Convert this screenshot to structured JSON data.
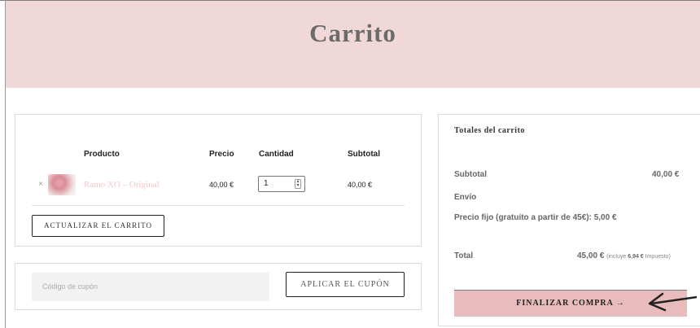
{
  "page": {
    "title": "Carrito"
  },
  "cart": {
    "headers": {
      "product": "Producto",
      "price": "Precio",
      "quantity": "Cantidad",
      "subtotal": "Subtotal"
    },
    "items": [
      {
        "remove": "×",
        "thumbnail_icon": "flower-bouquet-image",
        "name": "Ramo XO – Original",
        "price": "40,00 €",
        "quantity": "1",
        "subtotal": "40,00 €"
      }
    ],
    "update_button": "ACTUALIZAR EL CARRITO"
  },
  "coupon": {
    "placeholder": "Código de cupón",
    "apply_button": "APLICAR EL CUPÓN"
  },
  "totals": {
    "title": "Totales del carrito",
    "subtotal_label": "Subtotal",
    "subtotal_value": "40,00 €",
    "shipping_label": "Envío",
    "shipping_text": "Precio fijo (gratuito a partir de 45€): 5,00 €",
    "total_label": "Total",
    "total_value": "45,00 €",
    "tax_prefix": "(incluye",
    "tax_amount": "6,94 €",
    "tax_suffix": "Impuesto)",
    "checkout_button": "FINALIZAR COMPRA →"
  },
  "colors": {
    "hero_bg": "#f1d8d8",
    "checkout_bg": "#e8bcbc",
    "product_link": "#f3c8cf"
  },
  "annotation": {
    "icon": "arrow-pointer-icon"
  }
}
